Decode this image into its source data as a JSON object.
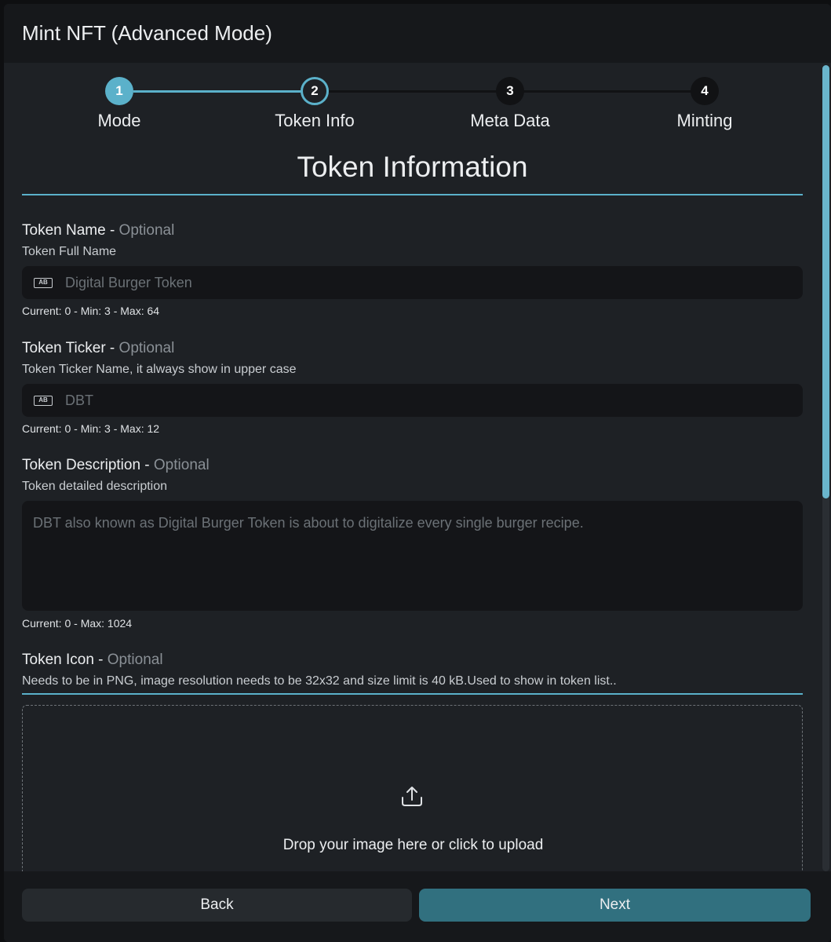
{
  "modal": {
    "title": "Mint NFT (Advanced Mode)"
  },
  "stepper": {
    "steps": [
      {
        "number": "1",
        "label": "Mode",
        "state": "complete"
      },
      {
        "number": "2",
        "label": "Token Info",
        "state": "active"
      },
      {
        "number": "3",
        "label": "Meta Data",
        "state": "pending"
      },
      {
        "number": "4",
        "label": "Minting",
        "state": "pending"
      }
    ]
  },
  "section": {
    "title": "Token Information"
  },
  "fields": {
    "name": {
      "label": "Token Name - ",
      "optional": "Optional",
      "help": "Token Full Name",
      "placeholder": "Digital Burger Token",
      "icon": "ab-text-icon",
      "count": "Current: 0 - Min: 3 - Max: 64"
    },
    "ticker": {
      "label": "Token Ticker - ",
      "optional": "Optional",
      "help": "Token Ticker Name, it always show in upper case",
      "placeholder": "DBT",
      "icon": "ab-text-icon",
      "count": "Current: 0 - Min: 3 - Max: 12"
    },
    "description": {
      "label": "Token Description - ",
      "optional": "Optional",
      "help": "Token detailed description",
      "placeholder": "DBT also known as Digital Burger Token is about to digitalize every single burger recipe.",
      "count": "Current: 0 - Max: 1024"
    },
    "icon": {
      "label": "Token Icon - ",
      "optional": "Optional",
      "help": "Needs to be in PNG, image resolution needs to be 32x32 and size limit is 40 kB.Used to show in token list..",
      "drop_text": "Drop your image here or click to upload",
      "drop_icon": "upload-icon"
    }
  },
  "footer": {
    "back_label": "Back",
    "next_label": "Next"
  },
  "colors": {
    "accent": "#5bb1ca",
    "step_complete": "#5bb1ca",
    "step_pending": "#111214",
    "next_button": "#31707f"
  }
}
